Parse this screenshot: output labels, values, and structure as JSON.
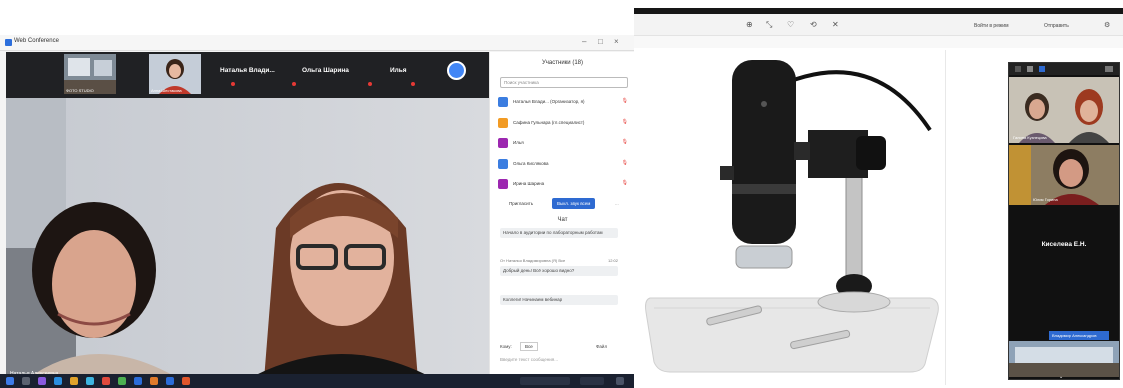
{
  "left": {
    "app_title": "Web Conference",
    "window_controls": [
      "–",
      "□",
      "×"
    ],
    "video_strip": {
      "thumbs": [
        {
          "caption": "ФОТО STUDIO"
        },
        {
          "caption": "Анна Шестакова"
        }
      ],
      "names": [
        "Наталья Влади...",
        "Ольга Шарина",
        "Илья"
      ]
    },
    "main_video": {
      "name": "Наталья Алексеевна"
    },
    "participants": {
      "title": "Участники (18)",
      "search_placeholder": "Поиск участника",
      "rows": [
        {
          "name": "Наталья Влади... (Организатор, я)",
          "color": "#3b7de0"
        },
        {
          "name": "Сафина Гульнара (гл.специалист)",
          "color": "#f29b24"
        },
        {
          "name": "Илья",
          "color": "#9c27b0"
        },
        {
          "name": "Ольга Кислякова",
          "color": "#3b7de0"
        },
        {
          "name": "Ирина Шарина",
          "color": "#9c27b0"
        }
      ],
      "invite_label": "Пригласить",
      "mute_all_label": "Выкл. звук всем",
      "more_label": "..."
    },
    "chat": {
      "title": "Чат",
      "messages": [
        {
          "text": "Начало в аудитории по лабораторным работам",
          "meta": ""
        },
        {
          "meta": "От Наталья Владимировна (Я) Все",
          "time": "12:02",
          "text": "Добрый день! Всё хорошо видно?"
        },
        {
          "meta": "",
          "text": "Коллеги! Начинаем вебинар"
        }
      ],
      "to_label": "Кому:",
      "to_value": "Все",
      "file_label": "Файл",
      "input_placeholder": "Введите текст сообщения..."
    }
  },
  "right": {
    "toolbar_symbols": [
      "⊕",
      "⤡",
      "♡",
      "⟲",
      "✕"
    ],
    "share_label": "Войти в режим",
    "file_label": "Отправить",
    "side_captions": [
      "Галина Кузнецова",
      "Юлия Горина",
      "Ольга Глухова"
    ],
    "big_name": "Киселева Е.Н.",
    "tag_label": "Владимир Александров"
  }
}
